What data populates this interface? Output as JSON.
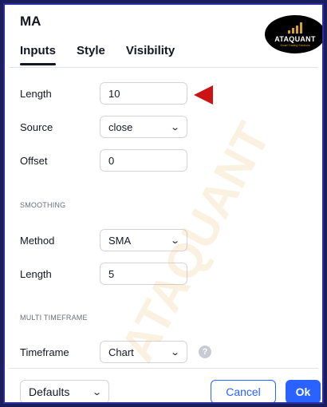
{
  "dialog": {
    "title": "MA"
  },
  "tabs": [
    {
      "label": "Inputs",
      "active": true
    },
    {
      "label": "Style",
      "active": false
    },
    {
      "label": "Visibility",
      "active": false
    }
  ],
  "inputs": {
    "length": {
      "label": "Length",
      "value": "10"
    },
    "source": {
      "label": "Source",
      "value": "close"
    },
    "offset": {
      "label": "Offset",
      "value": "0"
    }
  },
  "smoothing": {
    "section_label": "SMOOTHING",
    "method": {
      "label": "Method",
      "value": "SMA"
    },
    "length": {
      "label": "Length",
      "value": "5"
    }
  },
  "multi_timeframe": {
    "section_label": "MULTI TIMEFRAME",
    "timeframe": {
      "label": "Timeframe",
      "value": "Chart"
    },
    "help": "?"
  },
  "footer": {
    "defaults_label": "Defaults",
    "cancel_label": "Cancel",
    "ok_label": "Ok"
  },
  "brand": {
    "name": "ATAQUANT",
    "tagline": "Smart Trading Solutions",
    "watermark": "ATAQUANT"
  },
  "colors": {
    "accent": "#2962ff",
    "annotation_arrow": "#cc1212",
    "border": "#2a2ea0",
    "logo_gold": "#d7a227"
  },
  "icons": {
    "dropdown": "chevron-down-icon",
    "annotation": "red-arrow-icon",
    "help": "help-icon"
  }
}
